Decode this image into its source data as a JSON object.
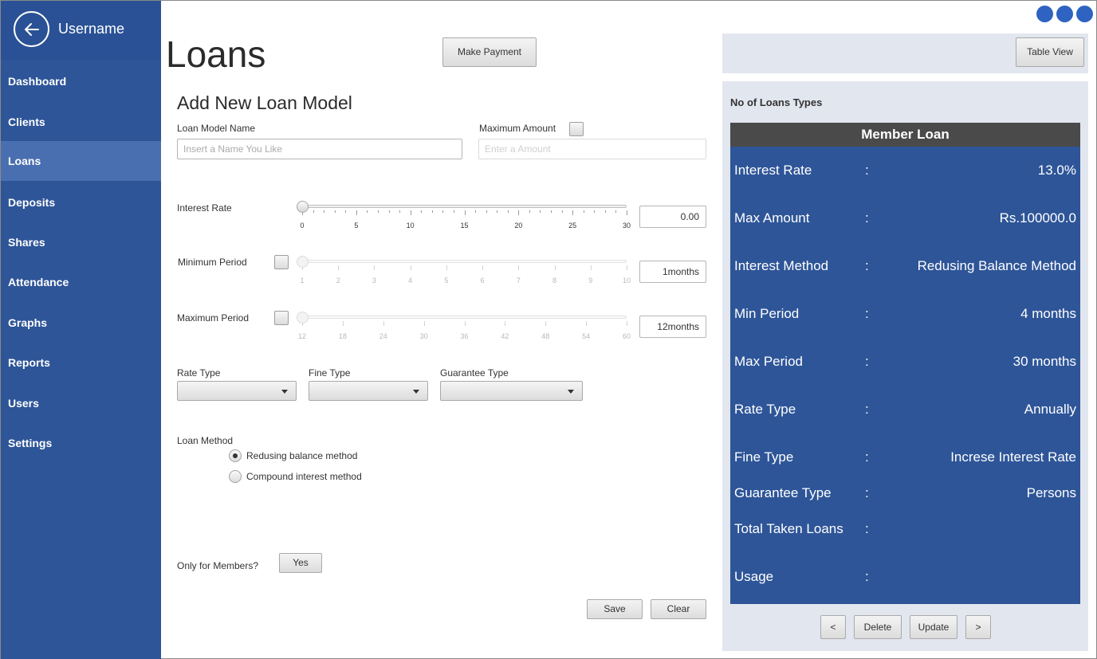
{
  "sidebar": {
    "username": "Username",
    "items": [
      {
        "label": "Dashboard"
      },
      {
        "label": "Clients"
      },
      {
        "label": "Loans"
      },
      {
        "label": "Deposits"
      },
      {
        "label": "Shares"
      },
      {
        "label": "Attendance"
      },
      {
        "label": "Graphs"
      },
      {
        "label": "Reports"
      },
      {
        "label": "Users"
      },
      {
        "label": "Settings"
      }
    ],
    "active_item": "Loans",
    "accent_color": "#2e5598"
  },
  "header": {
    "title": "Loans",
    "make_payment_label": "Make Payment"
  },
  "form": {
    "title": "Add New Loan Model",
    "loan_model_name_label": "Loan Model Name",
    "loan_model_name_placeholder": "Insert  a Name You Like",
    "maximum_amount_label": "Maximum Amount",
    "maximum_amount_placeholder": "Enter a Amount",
    "interest_rate": {
      "label": "Interest Rate",
      "value": "0.00",
      "min": 0,
      "max": 30,
      "ticks": [
        "0",
        "5",
        "10",
        "15",
        "20",
        "25",
        "30"
      ]
    },
    "minimum_period": {
      "label": "Minimum Period",
      "value": "1months",
      "min": 1,
      "max": 10,
      "ticks": [
        "1",
        "2",
        "3",
        "4",
        "5",
        "6",
        "7",
        "8",
        "9",
        "10"
      ]
    },
    "maximum_period": {
      "label": "Maximum Period",
      "value": "12months",
      "min": 12,
      "max": 60,
      "ticks": [
        "12",
        "18",
        "24",
        "30",
        "36",
        "42",
        "48",
        "54",
        "60"
      ]
    },
    "rate_type_label": "Rate Type",
    "fine_type_label": "Fine Type",
    "guarantee_type_label": "Guarantee Type",
    "loan_method_label": "Loan Method",
    "loan_method_options": [
      "Redusing balance method",
      "Compound interest method"
    ],
    "loan_method_selected": "Redusing balance method",
    "only_members_label": "Only for Members?",
    "only_members_button": "Yes",
    "save_label": "Save",
    "clear_label": "Clear"
  },
  "right_panel": {
    "table_view_label": "Table View",
    "caption": "No of Loans Types",
    "card_title": "Member Loan",
    "separator": ":",
    "rows": [
      {
        "key": "Interest Rate",
        "value": "13.0%"
      },
      {
        "key": "Max Amount",
        "value": "Rs.100000.0"
      },
      {
        "key": "Interest Method",
        "value": "Redusing Balance Method"
      },
      {
        "key": "Min Period",
        "value": "4 months"
      },
      {
        "key": "Max Period",
        "value": "30 months"
      },
      {
        "key": "Rate Type",
        "value": "Annually"
      },
      {
        "key": "Fine Type",
        "value": "Increse Interest Rate"
      },
      {
        "key": "Guarantee Type",
        "value": "Persons"
      },
      {
        "key": "Total Taken Loans",
        "value": ""
      },
      {
        "key": "Usage",
        "value": ""
      }
    ],
    "prev_label": "<",
    "delete_label": "Delete",
    "update_label": "Update",
    "next_label": ">"
  }
}
